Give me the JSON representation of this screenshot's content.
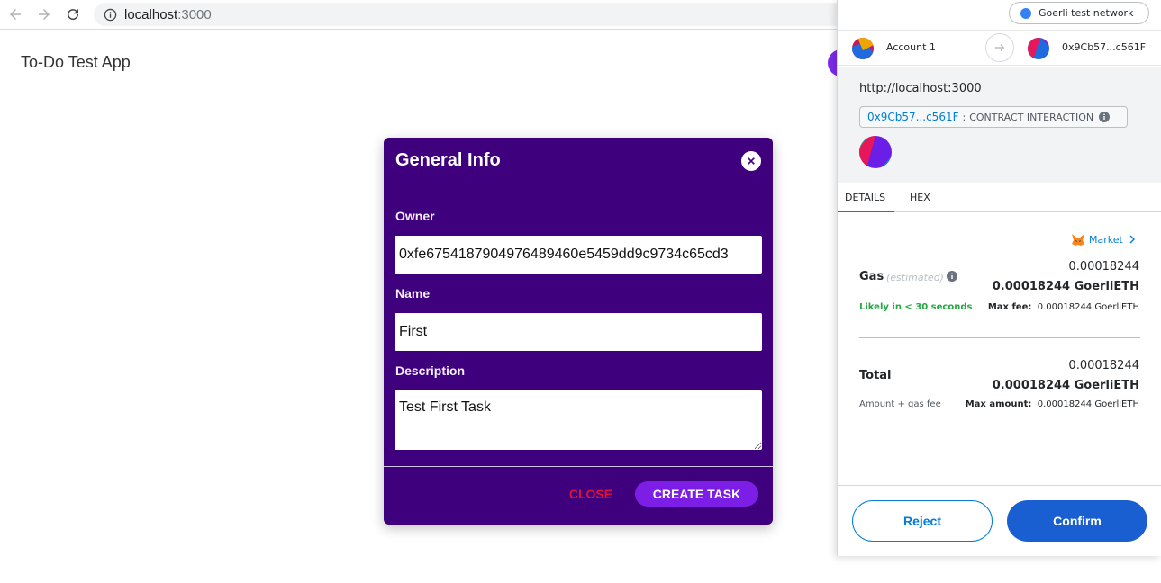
{
  "browser": {
    "url_host": "localhost",
    "url_port": ":3000",
    "back_icon": "arrow-left-icon",
    "forward_icon": "arrow-right-icon",
    "reload_icon": "reload-icon",
    "info_icon": "info-icon"
  },
  "app": {
    "title": "To-Do Test App"
  },
  "modal": {
    "title": "General Info",
    "owner_label": "Owner",
    "owner_value": "0xfe6754187904976489460e5459dd9c9734c65cd3",
    "name_label": "Name",
    "name_value": "First",
    "description_label": "Description",
    "description_value": "Test First Task",
    "close_label": "CLOSE",
    "create_label": "CREATE TASK",
    "colors": {
      "background": "#3e007d",
      "create_button": "#7d1ee6",
      "close_text": "#e0103c"
    }
  },
  "metamask": {
    "network": "Goerli test network",
    "from_account": "Account 1",
    "to_account": "0x9Cb57...c561F",
    "origin": "http://localhost:3000",
    "contract_address": "0x9Cb57...c561F",
    "contract_separator": ":",
    "contract_label": "CONTRACT INTERACTION",
    "tabs": [
      "DETAILS",
      "HEX"
    ],
    "market_label": "Market",
    "gas": {
      "label": "Gas",
      "sub": "(estimated)",
      "amount": "0.00018244",
      "amount_bold": "0.00018244 GoerliETH",
      "likely": "Likely in < 30 seconds",
      "max_fee_label": "Max fee:",
      "max_fee_value": "0.00018244 GoerliETH"
    },
    "total": {
      "label": "Total",
      "amount": "0.00018244",
      "amount_bold": "0.00018244 GoerliETH",
      "sub_left": "Amount + gas fee",
      "max_amount_label": "Max amount:",
      "max_amount_value": "0.00018244 GoerliETH"
    },
    "reject_label": "Reject",
    "confirm_label": "Confirm",
    "colors": {
      "primary": "#037dd6",
      "confirm": "#1a5fd1",
      "success": "#28a745"
    }
  }
}
